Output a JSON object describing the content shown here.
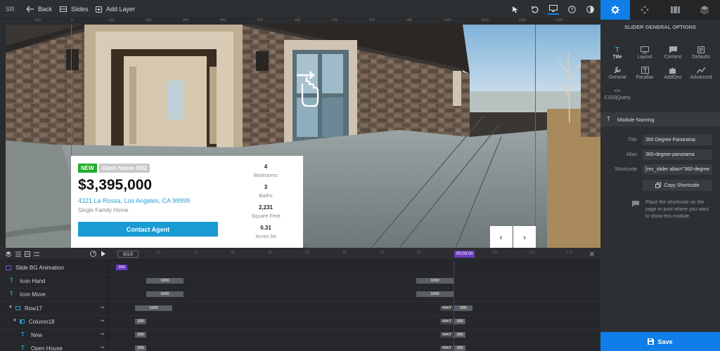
{
  "toolbar": {
    "logo": "SR",
    "back_label": "Back",
    "slides_label": "Slides",
    "add_layer_label": "Add Layer"
  },
  "ruler": {
    "top_ticks": [
      "-100",
      "0",
      "100",
      "200",
      "300",
      "400",
      "500",
      "600",
      "700",
      "800",
      "900",
      "1000",
      "1100",
      "1200",
      "1300"
    ]
  },
  "card": {
    "badge_new": "NEW",
    "badge_open": "Open house 8/02",
    "price": "$3,395,000",
    "address": "4321 La Rossa, Los Angeles, CA 99999",
    "property_type": "Single Family Home",
    "contact_label": "Contact Agent",
    "stats": [
      {
        "value": "4",
        "label": "Bedrooms"
      },
      {
        "value": "3",
        "label": "Baths"
      },
      {
        "value": "2,231",
        "label": "Square Feet"
      },
      {
        "value": "0.31",
        "label": "Acres lot"
      }
    ]
  },
  "nav": {
    "prev": "‹",
    "next": "›"
  },
  "timeline": {
    "state": "IDLE",
    "time_marker": "00:09:00",
    "seconds": [
      "1s",
      "2s",
      "3s",
      "4s",
      "5s",
      "6s",
      "7s",
      "8s",
      "9s",
      "10s",
      "11s",
      "12s"
    ],
    "rows": [
      {
        "name": "Slide BG Animation",
        "bars": [
          {
            "label": "300"
          }
        ]
      },
      {
        "name": "Icon Hand",
        "bars": [
          {
            "label": "1000"
          },
          {
            "label": "1000"
          }
        ]
      },
      {
        "name": "Icon Move",
        "bars": [
          {
            "label": "1000"
          },
          {
            "label": "1000"
          }
        ]
      },
      {
        "name": "Row17",
        "bars": [
          {
            "label": "1000"
          },
          {
            "label": "WAIT"
          },
          {
            "label": "500"
          }
        ]
      },
      {
        "name": "Column18",
        "bars": [
          {
            "label": "300"
          },
          {
            "label": "WAIT"
          },
          {
            "label": "300"
          }
        ]
      },
      {
        "name": "New",
        "bars": [
          {
            "label": "300"
          },
          {
            "label": "WAIT"
          },
          {
            "label": "300"
          }
        ]
      },
      {
        "name": "Open House",
        "bars": [
          {
            "label": "300"
          },
          {
            "label": "WAIT"
          },
          {
            "label": "300"
          }
        ]
      }
    ]
  },
  "panel": {
    "header": "SLIDER GENERAL OPTIONS",
    "items": [
      {
        "label": "Title"
      },
      {
        "label": "Layout"
      },
      {
        "label": "Content"
      },
      {
        "label": "Defaults"
      },
      {
        "label": "General"
      },
      {
        "label": "Parallax"
      },
      {
        "label": "AddOns"
      },
      {
        "label": "Advanced"
      },
      {
        "label": "CSS/jQuery"
      }
    ],
    "section_title": "Module Naming",
    "title_label": "Title",
    "title_value": "360 Degree Panorama",
    "alias_label": "Alias",
    "alias_value": "360-degree-panorama",
    "shortcode_label": "Shortcode",
    "shortcode_value": "[rev_slider alias=\"360-degree",
    "copy_label": "Copy Shortcode",
    "help_text": "Place the shortcode on the page or post where you want to show this module.",
    "save_label": "Save"
  },
  "colors": {
    "accent": "#0f7ee8",
    "new_badge": "#1fae2a",
    "contact": "#1b9bd3",
    "time_marker": "#6a3bbf"
  }
}
